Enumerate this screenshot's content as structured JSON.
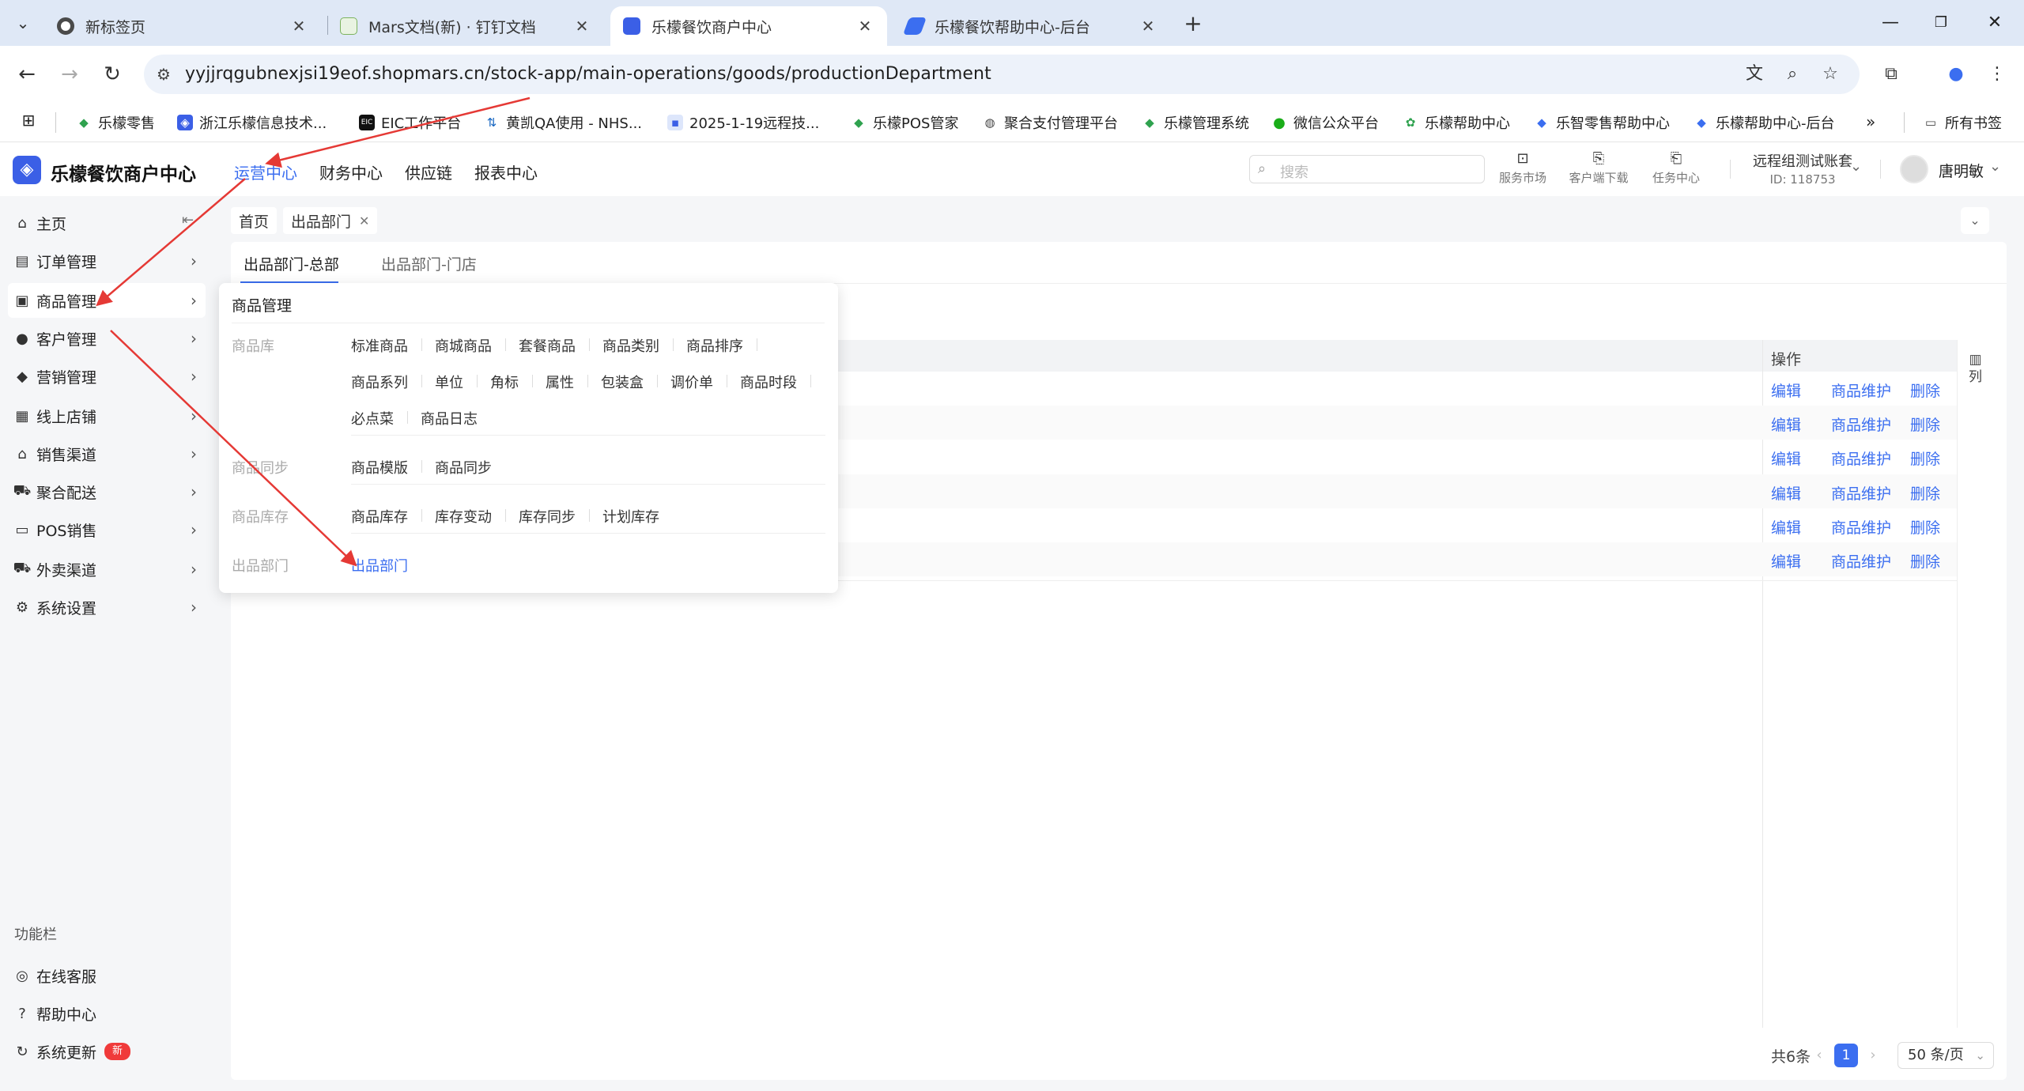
{
  "browser": {
    "tabs": [
      {
        "title": "新标签页",
        "active": false
      },
      {
        "title": "Mars文档(新) · 钉钉文档",
        "active": false
      },
      {
        "title": "乐檬餐饮商户中心",
        "active": true
      },
      {
        "title": "乐檬餐饮帮助中心-后台",
        "active": false
      }
    ],
    "new_tab": "+",
    "url": "yyjjrqgubnexjsi19eof.shopmars.cn/stock-app/main-operations/goods/productionDepartment",
    "bookmarks": [
      "乐檬零售",
      "浙江乐檬信息技术...",
      "EIC工作平台",
      "黄凯QA使用 - NHS...",
      "2025-1-19远程技...",
      "乐檬POS管家",
      "聚合支付管理平台",
      "乐檬管理系统",
      "微信公众平台",
      "乐檬帮助中心",
      "乐智零售帮助中心",
      "乐檬帮助中心-后台"
    ],
    "all_bookmarks": "所有书签",
    "colors": {
      "tabstrip": "#dfe8f6",
      "accent": "#3b6ef0"
    }
  },
  "header": {
    "app_name": "乐檬餐饮商户中心",
    "nav": [
      {
        "label": "运营中心",
        "active": true
      },
      {
        "label": "财务中心",
        "active": false
      },
      {
        "label": "供应链",
        "active": false
      },
      {
        "label": "报表中心",
        "active": false
      }
    ],
    "search_placeholder": "搜索",
    "tools": [
      "服务市场",
      "客户端下载",
      "任务中心"
    ],
    "account_name": "远程组测试账套",
    "account_id": "ID: 118753",
    "user_name": "唐明敏"
  },
  "sidebar": {
    "items": [
      {
        "label": "主页",
        "icon": "home-icon"
      },
      {
        "label": "订单管理",
        "icon": "order-icon"
      },
      {
        "label": "商品管理",
        "icon": "goods-icon",
        "active": true
      },
      {
        "label": "客户管理",
        "icon": "user-icon"
      },
      {
        "label": "营销管理",
        "icon": "tag-icon"
      },
      {
        "label": "线上店铺",
        "icon": "store-icon"
      },
      {
        "label": "销售渠道",
        "icon": "bank-icon"
      },
      {
        "label": "聚合配送",
        "icon": "truck-icon"
      },
      {
        "label": "POS销售",
        "icon": "pos-icon"
      },
      {
        "label": "外卖渠道",
        "icon": "scooter-icon"
      },
      {
        "label": "系统设置",
        "icon": "gear-icon"
      }
    ],
    "func_title": "功能栏",
    "func_items": [
      {
        "label": "在线客服",
        "icon": "headset-icon"
      },
      {
        "label": "帮助中心",
        "icon": "help-icon"
      },
      {
        "label": "系统更新",
        "icon": "refresh-icon",
        "badge": "新"
      }
    ]
  },
  "breadcrumb": {
    "home": "首页",
    "current": "出品部门"
  },
  "subtabs": [
    "出品部门-总部",
    "出品部门-门店"
  ],
  "table": {
    "op_header": "操作",
    "column_setting": "列",
    "row_actions": [
      "编辑",
      "商品维护",
      "删除"
    ],
    "row_count": 6
  },
  "pagination": {
    "total": "共6条",
    "current": "1",
    "page_size": "50 条/页"
  },
  "dropdown": {
    "title": "商品管理",
    "groups": [
      {
        "category": "商品库",
        "rows": [
          [
            "标准商品",
            "商城商品",
            "套餐商品",
            "商品类别",
            "商品排序"
          ],
          [
            "商品系列",
            "单位",
            "角标",
            "属性",
            "包装盒",
            "调价单",
            "商品时段"
          ],
          [
            "必点菜",
            "商品日志"
          ]
        ]
      },
      {
        "category": "商品同步",
        "rows": [
          [
            "商品模版",
            "商品同步"
          ]
        ]
      },
      {
        "category": "商品库存",
        "rows": [
          [
            "商品库存",
            "库存变动",
            "库存同步",
            "计划库存"
          ]
        ]
      },
      {
        "category": "出品部门",
        "rows": [
          [
            "出品部门"
          ]
        ]
      }
    ],
    "selected": "出品部门"
  }
}
